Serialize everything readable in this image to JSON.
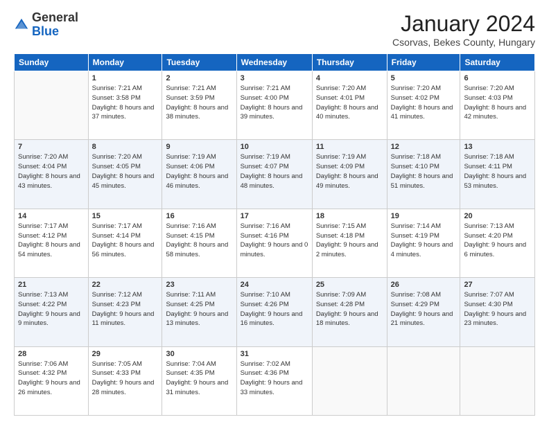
{
  "logo": {
    "general": "General",
    "blue": "Blue"
  },
  "header": {
    "month": "January 2024",
    "location": "Csorvas, Bekes County, Hungary"
  },
  "weekdays": [
    "Sunday",
    "Monday",
    "Tuesday",
    "Wednesday",
    "Thursday",
    "Friday",
    "Saturday"
  ],
  "weeks": [
    [
      {
        "day": "",
        "sunrise": "",
        "sunset": "",
        "daylight": ""
      },
      {
        "day": "1",
        "sunrise": "Sunrise: 7:21 AM",
        "sunset": "Sunset: 3:58 PM",
        "daylight": "Daylight: 8 hours and 37 minutes."
      },
      {
        "day": "2",
        "sunrise": "Sunrise: 7:21 AM",
        "sunset": "Sunset: 3:59 PM",
        "daylight": "Daylight: 8 hours and 38 minutes."
      },
      {
        "day": "3",
        "sunrise": "Sunrise: 7:21 AM",
        "sunset": "Sunset: 4:00 PM",
        "daylight": "Daylight: 8 hours and 39 minutes."
      },
      {
        "day": "4",
        "sunrise": "Sunrise: 7:20 AM",
        "sunset": "Sunset: 4:01 PM",
        "daylight": "Daylight: 8 hours and 40 minutes."
      },
      {
        "day": "5",
        "sunrise": "Sunrise: 7:20 AM",
        "sunset": "Sunset: 4:02 PM",
        "daylight": "Daylight: 8 hours and 41 minutes."
      },
      {
        "day": "6",
        "sunrise": "Sunrise: 7:20 AM",
        "sunset": "Sunset: 4:03 PM",
        "daylight": "Daylight: 8 hours and 42 minutes."
      }
    ],
    [
      {
        "day": "7",
        "sunrise": "Sunrise: 7:20 AM",
        "sunset": "Sunset: 4:04 PM",
        "daylight": "Daylight: 8 hours and 43 minutes."
      },
      {
        "day": "8",
        "sunrise": "Sunrise: 7:20 AM",
        "sunset": "Sunset: 4:05 PM",
        "daylight": "Daylight: 8 hours and 45 minutes."
      },
      {
        "day": "9",
        "sunrise": "Sunrise: 7:19 AM",
        "sunset": "Sunset: 4:06 PM",
        "daylight": "Daylight: 8 hours and 46 minutes."
      },
      {
        "day": "10",
        "sunrise": "Sunrise: 7:19 AM",
        "sunset": "Sunset: 4:07 PM",
        "daylight": "Daylight: 8 hours and 48 minutes."
      },
      {
        "day": "11",
        "sunrise": "Sunrise: 7:19 AM",
        "sunset": "Sunset: 4:09 PM",
        "daylight": "Daylight: 8 hours and 49 minutes."
      },
      {
        "day": "12",
        "sunrise": "Sunrise: 7:18 AM",
        "sunset": "Sunset: 4:10 PM",
        "daylight": "Daylight: 8 hours and 51 minutes."
      },
      {
        "day": "13",
        "sunrise": "Sunrise: 7:18 AM",
        "sunset": "Sunset: 4:11 PM",
        "daylight": "Daylight: 8 hours and 53 minutes."
      }
    ],
    [
      {
        "day": "14",
        "sunrise": "Sunrise: 7:17 AM",
        "sunset": "Sunset: 4:12 PM",
        "daylight": "Daylight: 8 hours and 54 minutes."
      },
      {
        "day": "15",
        "sunrise": "Sunrise: 7:17 AM",
        "sunset": "Sunset: 4:14 PM",
        "daylight": "Daylight: 8 hours and 56 minutes."
      },
      {
        "day": "16",
        "sunrise": "Sunrise: 7:16 AM",
        "sunset": "Sunset: 4:15 PM",
        "daylight": "Daylight: 8 hours and 58 minutes."
      },
      {
        "day": "17",
        "sunrise": "Sunrise: 7:16 AM",
        "sunset": "Sunset: 4:16 PM",
        "daylight": "Daylight: 9 hours and 0 minutes."
      },
      {
        "day": "18",
        "sunrise": "Sunrise: 7:15 AM",
        "sunset": "Sunset: 4:18 PM",
        "daylight": "Daylight: 9 hours and 2 minutes."
      },
      {
        "day": "19",
        "sunrise": "Sunrise: 7:14 AM",
        "sunset": "Sunset: 4:19 PM",
        "daylight": "Daylight: 9 hours and 4 minutes."
      },
      {
        "day": "20",
        "sunrise": "Sunrise: 7:13 AM",
        "sunset": "Sunset: 4:20 PM",
        "daylight": "Daylight: 9 hours and 6 minutes."
      }
    ],
    [
      {
        "day": "21",
        "sunrise": "Sunrise: 7:13 AM",
        "sunset": "Sunset: 4:22 PM",
        "daylight": "Daylight: 9 hours and 9 minutes."
      },
      {
        "day": "22",
        "sunrise": "Sunrise: 7:12 AM",
        "sunset": "Sunset: 4:23 PM",
        "daylight": "Daylight: 9 hours and 11 minutes."
      },
      {
        "day": "23",
        "sunrise": "Sunrise: 7:11 AM",
        "sunset": "Sunset: 4:25 PM",
        "daylight": "Daylight: 9 hours and 13 minutes."
      },
      {
        "day": "24",
        "sunrise": "Sunrise: 7:10 AM",
        "sunset": "Sunset: 4:26 PM",
        "daylight": "Daylight: 9 hours and 16 minutes."
      },
      {
        "day": "25",
        "sunrise": "Sunrise: 7:09 AM",
        "sunset": "Sunset: 4:28 PM",
        "daylight": "Daylight: 9 hours and 18 minutes."
      },
      {
        "day": "26",
        "sunrise": "Sunrise: 7:08 AM",
        "sunset": "Sunset: 4:29 PM",
        "daylight": "Daylight: 9 hours and 21 minutes."
      },
      {
        "day": "27",
        "sunrise": "Sunrise: 7:07 AM",
        "sunset": "Sunset: 4:30 PM",
        "daylight": "Daylight: 9 hours and 23 minutes."
      }
    ],
    [
      {
        "day": "28",
        "sunrise": "Sunrise: 7:06 AM",
        "sunset": "Sunset: 4:32 PM",
        "daylight": "Daylight: 9 hours and 26 minutes."
      },
      {
        "day": "29",
        "sunrise": "Sunrise: 7:05 AM",
        "sunset": "Sunset: 4:33 PM",
        "daylight": "Daylight: 9 hours and 28 minutes."
      },
      {
        "day": "30",
        "sunrise": "Sunrise: 7:04 AM",
        "sunset": "Sunset: 4:35 PM",
        "daylight": "Daylight: 9 hours and 31 minutes."
      },
      {
        "day": "31",
        "sunrise": "Sunrise: 7:02 AM",
        "sunset": "Sunset: 4:36 PM",
        "daylight": "Daylight: 9 hours and 33 minutes."
      },
      {
        "day": "",
        "sunrise": "",
        "sunset": "",
        "daylight": ""
      },
      {
        "day": "",
        "sunrise": "",
        "sunset": "",
        "daylight": ""
      },
      {
        "day": "",
        "sunrise": "",
        "sunset": "",
        "daylight": ""
      }
    ]
  ]
}
